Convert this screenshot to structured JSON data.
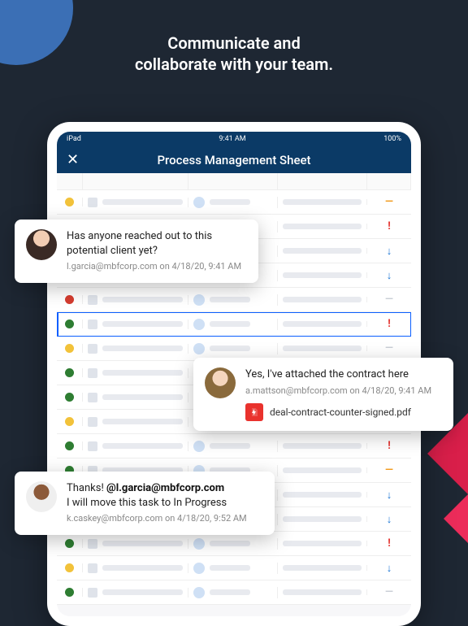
{
  "headline": {
    "line1": "Communicate and",
    "line2": "collaborate with your team."
  },
  "statusbar": {
    "left": "iPad",
    "time": "9:41 AM",
    "battery": "100%"
  },
  "appbar": {
    "title": "Process Management Sheet",
    "close_aria": "Close"
  },
  "sheet": {
    "selected_row_number": "6",
    "columns_count": 5,
    "rows": [
      {
        "dot": "#f2c23a",
        "mark": "—",
        "markClass": "orange"
      },
      {
        "dot": "#2e7d32",
        "mark": "!",
        "markClass": "red"
      },
      {
        "dot": "#f2c23a",
        "mark": "↓",
        "markClass": "blue"
      },
      {
        "dot": "#f2c23a",
        "mark": "↓",
        "markClass": "blue"
      },
      {
        "dot": "#d43c2f",
        "mark": "—",
        "markClass": "gray"
      },
      {
        "dot": "#2e7d32",
        "mark": "!",
        "markClass": "red",
        "selected": true
      },
      {
        "dot": "#f2c23a",
        "mark": "—",
        "markClass": "gray"
      },
      {
        "dot": "#2e7d32",
        "mark": "—",
        "markClass": "orange"
      },
      {
        "dot": "#2e7d32",
        "mark": "—",
        "markClass": "gray"
      },
      {
        "dot": "#f2c23a",
        "mark": "—",
        "markClass": "orange"
      },
      {
        "dot": "#2e7d32",
        "mark": "!",
        "markClass": "red"
      },
      {
        "dot": "#2e7d32",
        "mark": "—",
        "markClass": "orange"
      },
      {
        "dot": "#f2c23a",
        "mark": "↓",
        "markClass": "blue"
      },
      {
        "dot": "#f2c23a",
        "mark": "↓",
        "markClass": "blue"
      },
      {
        "dot": "#2e7d32",
        "mark": "!",
        "markClass": "red"
      },
      {
        "dot": "#f2c23a",
        "mark": "↓",
        "markClass": "blue"
      },
      {
        "dot": "#2e7d32",
        "mark": "—",
        "markClass": "gray"
      }
    ]
  },
  "bubbles": [
    {
      "text": "Has anyone reached out to this potential client yet?",
      "meta": "l.garcia@mbfcorp.com on 4/18/20, 9:41 AM"
    },
    {
      "text": "Yes, I've attached the contract here",
      "meta": "a.mattson@mbfcorp.com on 4/18/20, 9:41 AM",
      "attachment": "deal-contract-counter-signed.pdf"
    },
    {
      "text_pre": "Thanks! ",
      "mention": "@l.garcia@mbfcorp.com",
      "text_post": " I will move this task to In Progress",
      "meta": "k.caskey@mbfcorp.com on 4/18/20, 9:52 AM"
    }
  ]
}
